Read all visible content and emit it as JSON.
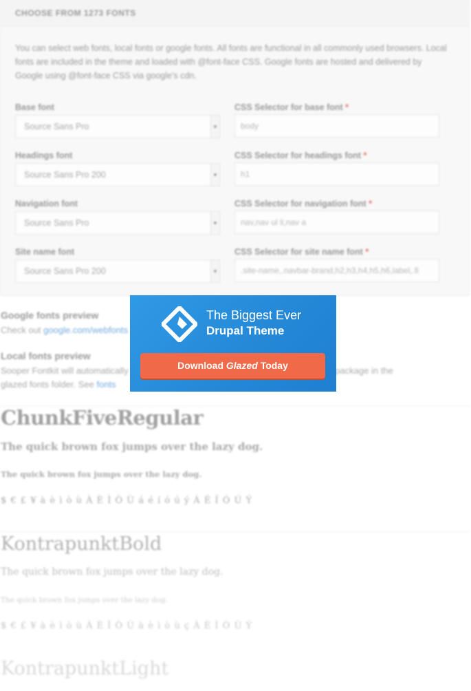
{
  "panel": {
    "title": "CHOOSE FROM 1273 FONTS",
    "description": "You can select web fonts, local fonts or google fonts. All fonts are functional in all commonly used browsers. Local fonts are included in the theme and loaded with @font-face CSS. Google fonts are hosted and delivered by Google using @font-face CSS via google's cdn.",
    "rows": [
      {
        "font_label": "Base font",
        "font_value": "Source Sans Pro",
        "selector_label": "CSS Selector for base font",
        "selector_value": "body"
      },
      {
        "font_label": "Headings font",
        "font_value": "Source Sans Pro 200",
        "selector_label": "CSS Selector for headings font",
        "selector_value": "h1"
      },
      {
        "font_label": "Navigation font",
        "font_value": "Source Sans Pro",
        "selector_label": "CSS Selector for navigation font",
        "selector_value": "nav,nav ul li,nav a"
      },
      {
        "font_label": "Site name font",
        "font_value": "Source Sans Pro 200",
        "selector_label": "CSS Selector for site name font",
        "selector_value": ".site-name,.navbar-brand,h2,h3,h4,h5,h6,label,.fi"
      }
    ],
    "required_mark": "*"
  },
  "google_preview": {
    "heading": "Google fonts preview",
    "text_prefix": "Check out",
    "link": "google.com/webfonts"
  },
  "local_preview": {
    "heading": "Local fonts preview",
    "line1_prefix": "Sooper Fontkit will automatically load",
    "line1_suffix": "@font-face package in the",
    "line2_prefix": "glazed fonts folder. See",
    "line2_link": "fonts"
  },
  "fonts": [
    {
      "name": "ChunkFiveRegular",
      "sample_large": "The quick brown fox jumps over the lazy dog.",
      "sample_small": "The quick brown fox jumps over the lazy dog.",
      "glyphs": "$ € £ ¥ à è ì ò ù À È Ì Ò Ù á é í ó ú ý Á É Í Ó Ú Ý"
    },
    {
      "name": "KontrapunktBold",
      "sample_large": "The quick brown fox jumps over the lazy dog.",
      "sample_small": "The quick brown fox jumps over the lazy dog.",
      "glyphs": "$ € £ ¥ à è ì ò ù À È Ì Ò Ù à è ì ò ù ç À È Ì Ò Ù Ý"
    },
    {
      "name": "KontrapunktLight"
    }
  ],
  "ad": {
    "line1": "The Biggest Ever",
    "line2": "Drupal Theme",
    "button_prefix": "Download",
    "button_emph": "Glazed",
    "button_suffix": "Today",
    "colors": {
      "background": "#2589d8",
      "button": "#f06a4a"
    },
    "logo_icon": "glazed-logo-icon"
  }
}
